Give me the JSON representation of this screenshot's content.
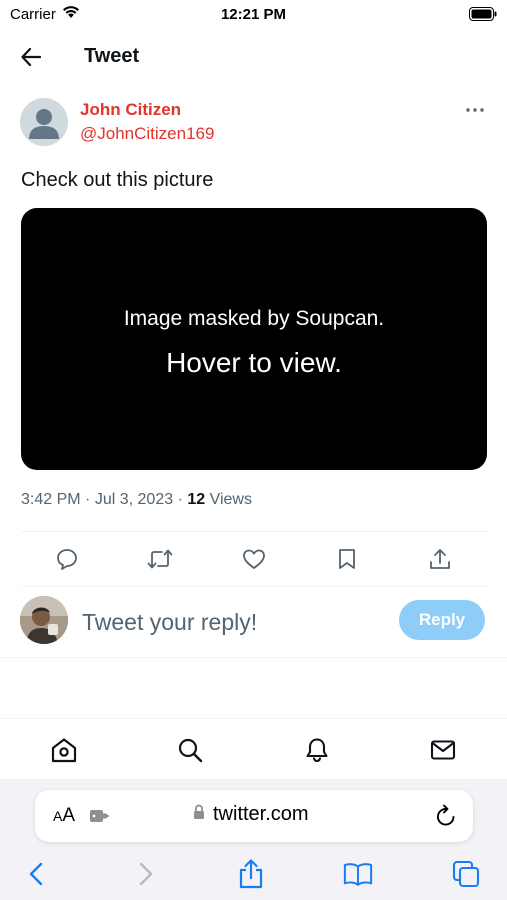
{
  "status_bar": {
    "carrier": "Carrier",
    "time": "12:21 PM"
  },
  "header": {
    "title": "Tweet"
  },
  "tweet": {
    "author_name": "John Citizen",
    "author_handle": "@JohnCitizen169",
    "text": "Check out this picture",
    "image_mask": {
      "line1": "Image masked by Soupcan.",
      "line2": "Hover to view."
    },
    "time": "3:42 PM",
    "date": "Jul 3, 2023",
    "separator": "·",
    "views_count": "12",
    "views_label": "Views"
  },
  "reply": {
    "placeholder": "Tweet your reply!",
    "button_label": "Reply"
  },
  "browser": {
    "aa_small": "A",
    "aa_large": "A",
    "url": "twitter.com"
  },
  "colors": {
    "author_accent": "#e0352b",
    "reply_button": "#8ecdf8",
    "browser_blue": "#1a7cf5"
  }
}
